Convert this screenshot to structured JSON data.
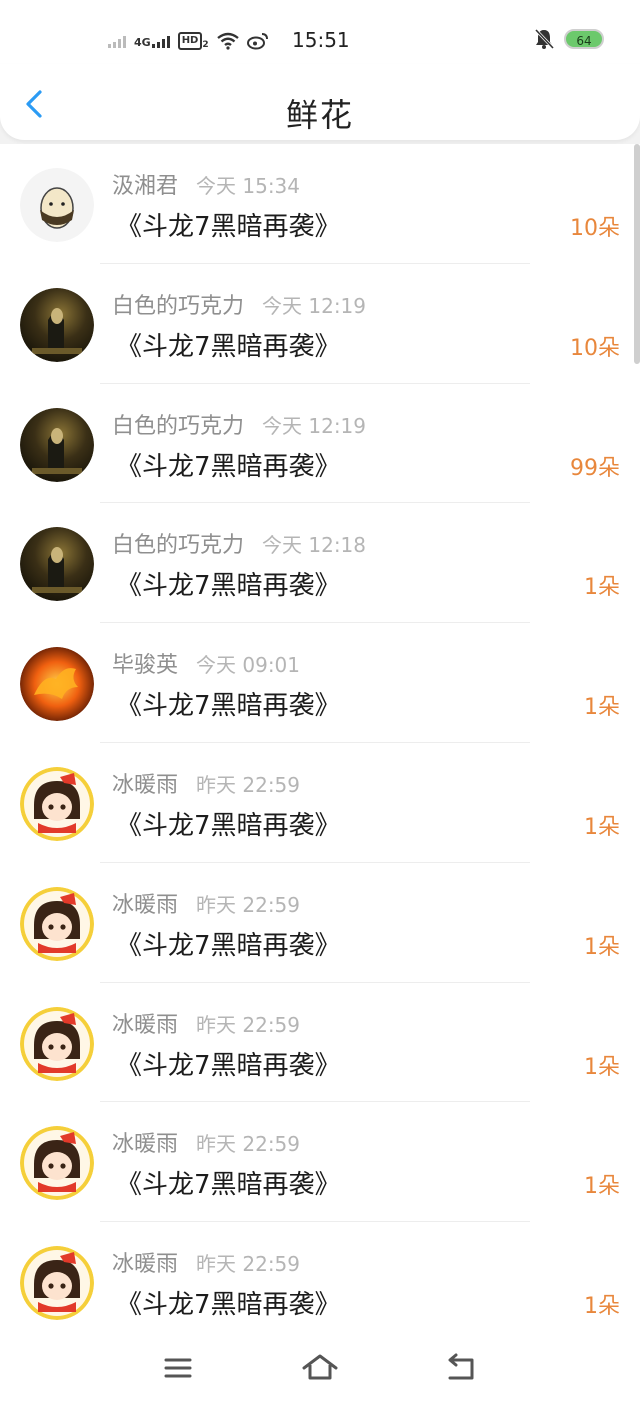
{
  "status_bar": {
    "network": "4G",
    "hd": "HD",
    "hd_sub": "2",
    "time": "15:51",
    "battery": "64"
  },
  "header": {
    "title": "鲜花"
  },
  "items": [
    {
      "name": "汲湘君",
      "time": "今天 15:34",
      "work": "《斗龙7黑暗再袭》",
      "count": "10朵",
      "avatar": "egg"
    },
    {
      "name": "白色的巧克力",
      "time": "今天 12:19",
      "work": "《斗龙7黑暗再袭》",
      "count": "10朵",
      "avatar": "dark"
    },
    {
      "name": "白色的巧克力",
      "time": "今天 12:19",
      "work": "《斗龙7黑暗再袭》",
      "count": "99朵",
      "avatar": "dark"
    },
    {
      "name": "白色的巧克力",
      "time": "今天 12:18",
      "work": "《斗龙7黑暗再袭》",
      "count": "1朵",
      "avatar": "dark"
    },
    {
      "name": "毕骏英",
      "time": "今天 09:01",
      "work": "《斗龙7黑暗再袭》",
      "count": "1朵",
      "avatar": "fire"
    },
    {
      "name": "冰暖雨",
      "time": "昨天 22:59",
      "work": "《斗龙7黑暗再袭》",
      "count": "1朵",
      "avatar": "girl"
    },
    {
      "name": "冰暖雨",
      "time": "昨天 22:59",
      "work": "《斗龙7黑暗再袭》",
      "count": "1朵",
      "avatar": "girl"
    },
    {
      "name": "冰暖雨",
      "time": "昨天 22:59",
      "work": "《斗龙7黑暗再袭》",
      "count": "1朵",
      "avatar": "girl"
    },
    {
      "name": "冰暖雨",
      "time": "昨天 22:59",
      "work": "《斗龙7黑暗再袭》",
      "count": "1朵",
      "avatar": "girl"
    },
    {
      "name": "冰暖雨",
      "time": "昨天 22:59",
      "work": "《斗龙7黑暗再袭》",
      "count": "1朵",
      "avatar": "girl"
    }
  ],
  "colors": {
    "accent": "#2b9bf4",
    "count": "#e8873c",
    "name": "#8f8f8f",
    "time": "#b5b5b5"
  },
  "icons": {
    "back": "chevron-left-icon",
    "menu": "menu-icon",
    "home": "home-icon",
    "return": "back-arrow-icon",
    "mute": "bell-muted-icon",
    "wifi": "wifi-icon",
    "weibo": "weibo-icon"
  }
}
